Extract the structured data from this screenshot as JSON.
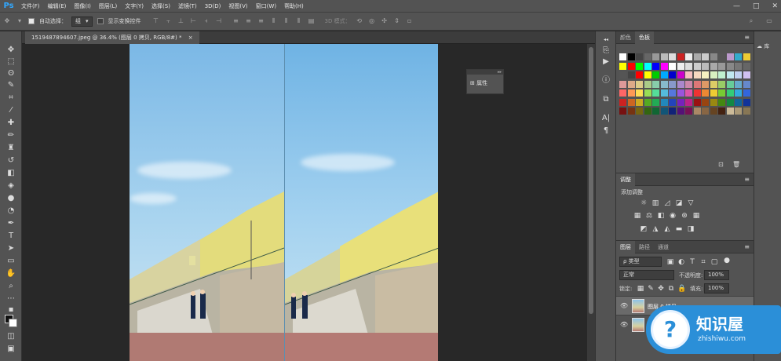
{
  "app": {
    "logo": "Ps"
  },
  "menu": [
    "文件(F)",
    "编辑(E)",
    "图像(I)",
    "图层(L)",
    "文字(Y)",
    "选择(S)",
    "滤镜(T)",
    "3D(D)",
    "视图(V)",
    "窗口(W)",
    "帮助(H)"
  ],
  "window_controls": [
    "—",
    "□",
    "✕"
  ],
  "options": {
    "auto_select_label": "自动选择：",
    "auto_select_value": "组",
    "show_transform_label": "显示变换控件",
    "mode_3d_label": "3D 模式："
  },
  "document": {
    "tab_title": "1519487894607.jpeg @ 36.4% (图层 0 拷贝, RGB/8#) *"
  },
  "properties_panel": {
    "label": "属性"
  },
  "swatches_panel": {
    "tab_color": "颜色",
    "tab_swatches": "色板"
  },
  "adjustments_panel": {
    "tab": "调整",
    "add_label": "添加调整"
  },
  "layers_panel": {
    "tabs": [
      "图层",
      "路径",
      "通道"
    ],
    "filter_kind": "ρ 类型",
    "blend_mode": "正常",
    "opacity_label": "不透明度:",
    "opacity_value": "100%",
    "lock_label": "锁定:",
    "fill_label": "填充:",
    "fill_value": "100%",
    "layers": [
      {
        "name": "图层 0 拷贝"
      },
      {
        "name": ""
      }
    ]
  },
  "library_label": "库",
  "watermark": {
    "title": "知识屋",
    "subtitle": "zhishiwu.com"
  }
}
